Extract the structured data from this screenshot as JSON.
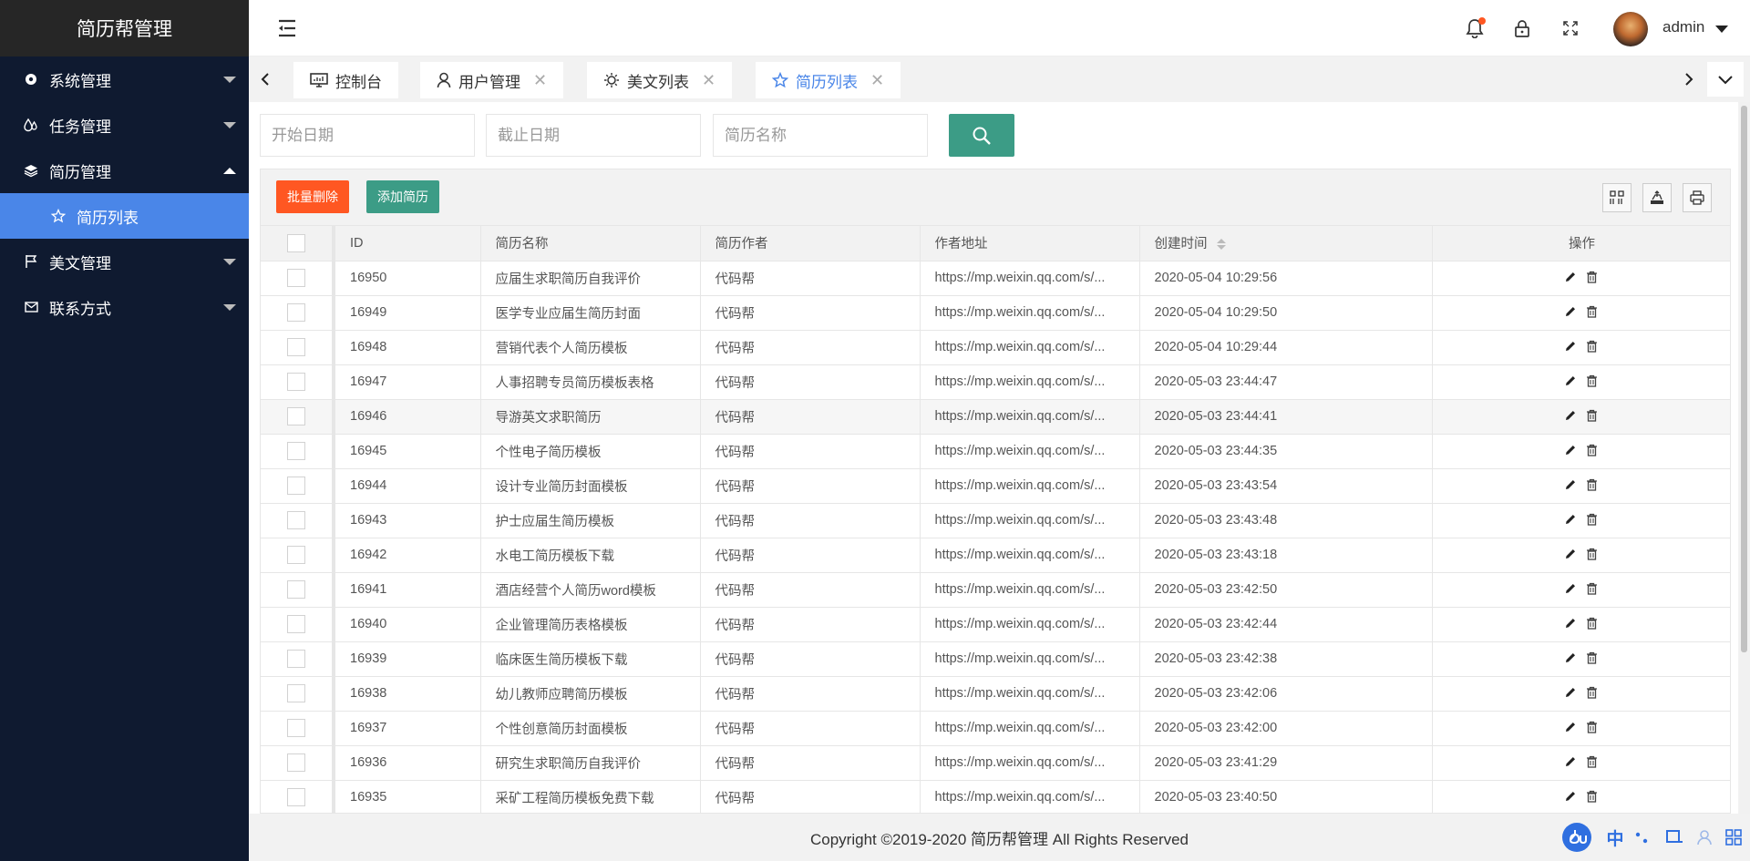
{
  "app": {
    "title": "简历帮管理"
  },
  "sidebar": {
    "items": [
      {
        "label": "系统管理",
        "icon": "gear-icon"
      },
      {
        "label": "任务管理",
        "icon": "drops-icon"
      },
      {
        "label": "简历管理",
        "icon": "layers-icon",
        "expanded": true
      },
      {
        "label": "美文管理",
        "icon": "flag-icon"
      },
      {
        "label": "联系方式",
        "icon": "mail-icon"
      }
    ],
    "sub_item": {
      "label": "简历列表",
      "icon": "star-icon"
    }
  },
  "header": {
    "username": "admin"
  },
  "tabs": [
    {
      "label": "控制台",
      "icon": "monitor-icon"
    },
    {
      "label": "用户管理",
      "icon": "user-icon"
    },
    {
      "label": "美文列表",
      "icon": "sun-icon"
    },
    {
      "label": "简历列表",
      "icon": "star-icon",
      "active": true
    }
  ],
  "search": {
    "start_placeholder": "开始日期",
    "end_placeholder": "截止日期",
    "name_placeholder": "简历名称"
  },
  "toolbar": {
    "batch_delete": "批量删除",
    "add_resume": "添加简历"
  },
  "table": {
    "columns": [
      "ID",
      "简历名称",
      "简历作者",
      "作者地址",
      "创建时间",
      "操作"
    ],
    "rows": [
      {
        "id": "16950",
        "name": "应届生求职简历自我评价",
        "author": "代码帮",
        "url": "https://mp.weixin.qq.com/s/...",
        "time": "2020-05-04 10:29:56"
      },
      {
        "id": "16949",
        "name": "医学专业应届生简历封面",
        "author": "代码帮",
        "url": "https://mp.weixin.qq.com/s/...",
        "time": "2020-05-04 10:29:50"
      },
      {
        "id": "16948",
        "name": "营销代表个人简历模板",
        "author": "代码帮",
        "url": "https://mp.weixin.qq.com/s/...",
        "time": "2020-05-04 10:29:44"
      },
      {
        "id": "16947",
        "name": "人事招聘专员简历模板表格",
        "author": "代码帮",
        "url": "https://mp.weixin.qq.com/s/...",
        "time": "2020-05-03 23:44:47"
      },
      {
        "id": "16946",
        "name": "导游英文求职简历",
        "author": "代码帮",
        "url": "https://mp.weixin.qq.com/s/...",
        "time": "2020-05-03 23:44:41"
      },
      {
        "id": "16945",
        "name": "个性电子简历模板",
        "author": "代码帮",
        "url": "https://mp.weixin.qq.com/s/...",
        "time": "2020-05-03 23:44:35"
      },
      {
        "id": "16944",
        "name": "设计专业简历封面模板",
        "author": "代码帮",
        "url": "https://mp.weixin.qq.com/s/...",
        "time": "2020-05-03 23:43:54"
      },
      {
        "id": "16943",
        "name": "护士应届生简历模板",
        "author": "代码帮",
        "url": "https://mp.weixin.qq.com/s/...",
        "time": "2020-05-03 23:43:48"
      },
      {
        "id": "16942",
        "name": "水电工简历模板下载",
        "author": "代码帮",
        "url": "https://mp.weixin.qq.com/s/...",
        "time": "2020-05-03 23:43:18"
      },
      {
        "id": "16941",
        "name": "酒店经营个人简历word模板",
        "author": "代码帮",
        "url": "https://mp.weixin.qq.com/s/...",
        "time": "2020-05-03 23:42:50"
      },
      {
        "id": "16940",
        "name": "企业管理简历表格模板",
        "author": "代码帮",
        "url": "https://mp.weixin.qq.com/s/...",
        "time": "2020-05-03 23:42:44"
      },
      {
        "id": "16939",
        "name": "临床医生简历模板下载",
        "author": "代码帮",
        "url": "https://mp.weixin.qq.com/s/...",
        "time": "2020-05-03 23:42:38"
      },
      {
        "id": "16938",
        "name": "幼儿教师应聘简历模板",
        "author": "代码帮",
        "url": "https://mp.weixin.qq.com/s/...",
        "time": "2020-05-03 23:42:06"
      },
      {
        "id": "16937",
        "name": "个性创意简历封面模板",
        "author": "代码帮",
        "url": "https://mp.weixin.qq.com/s/...",
        "time": "2020-05-03 23:42:00"
      },
      {
        "id": "16936",
        "name": "研究生求职简历自我评价",
        "author": "代码帮",
        "url": "https://mp.weixin.qq.com/s/...",
        "time": "2020-05-03 23:41:29"
      },
      {
        "id": "16935",
        "name": "采矿工程简历模板免费下载",
        "author": "代码帮",
        "url": "https://mp.weixin.qq.com/s/...",
        "time": "2020-05-03 23:40:50"
      }
    ]
  },
  "footer": {
    "copyright": "Copyright ©2019-2020 简历帮管理 All Rights Reserved"
  },
  "ime": {
    "lang_label": "中"
  },
  "colors": {
    "sidebar_bg": "#0f1a30",
    "accent_blue": "#4a86e8",
    "teal": "#3c9c86",
    "danger": "#ff5722"
  }
}
